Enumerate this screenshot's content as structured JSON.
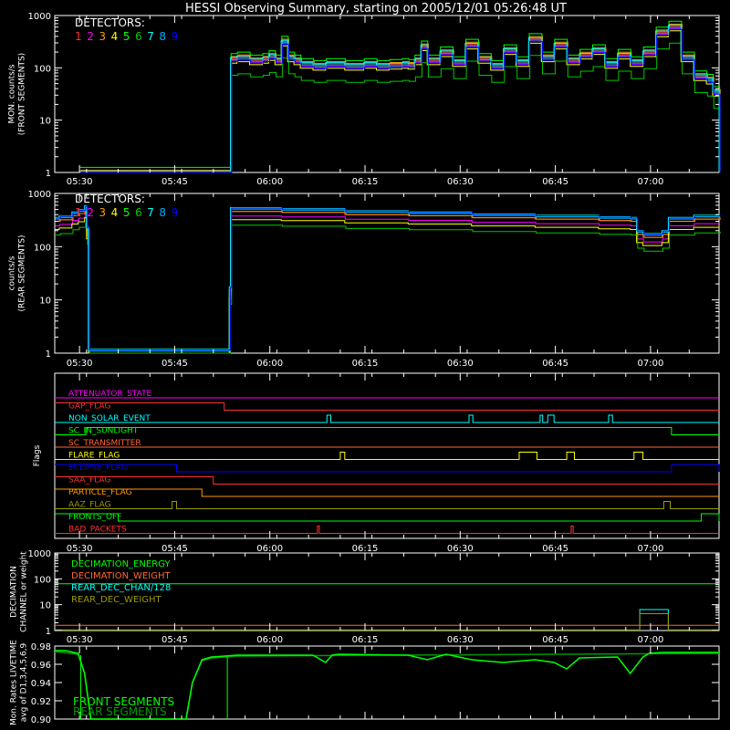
{
  "title": "HESSI Observing Summary, starting on 2005/12/01 05:26:48 UT",
  "time_ticks": [
    "05:30",
    "05:45",
    "06:00",
    "06:15",
    "06:30",
    "06:45",
    "07:00"
  ],
  "detector_colors": [
    "#ff3030",
    "#ff00ff",
    "#ff9900",
    "#ffff00",
    "#00ff00",
    "#00c800",
    "#00ffff",
    "#00aaff",
    "#0000ff"
  ],
  "chart_data": [
    {
      "type": "line",
      "ylabel": "MON. counts/s\n(FRONT SEGMENTS)",
      "y_scale": "log",
      "ylim": [
        1,
        1000
      ],
      "y_ticks": [
        "1",
        "10",
        "100",
        "1000"
      ],
      "legend_title": "DETECTORS:",
      "legend_items": [
        "1",
        "2",
        "3",
        "4",
        "5",
        "6",
        "7",
        "8",
        "9"
      ],
      "x_minutes": [
        3.2,
        26.5,
        27.0,
        28.0,
        30.0,
        32.0,
        33.0,
        34.0,
        35.0,
        36.0,
        37.0,
        38.0,
        39.0,
        40.0,
        42.0,
        45.0,
        48.0,
        50.0,
        52.0,
        54.0,
        55.0,
        56.0,
        57.0,
        58.0,
        60.0,
        62.0,
        64.0,
        66.0,
        68.0,
        70.0,
        72.0,
        74.0,
        76.0,
        78.0,
        80.0,
        82.0,
        84.0,
        86.0,
        88.0,
        90.0,
        92.0,
        94.0,
        96.0,
        98.0,
        100.0,
        101.0,
        102.0,
        103.0,
        104.0
      ],
      "series": [
        {
          "values": [
            1,
            1,
            150,
            160,
            140,
            150,
            170,
            140,
            320,
            160,
            140,
            120,
            120,
            110,
            120,
            110,
            120,
            110,
            115,
            120,
            115,
            140,
            260,
            140,
            200,
            130,
            280,
            150,
            110,
            220,
            130,
            360,
            160,
            280,
            140,
            180,
            220,
            120,
            180,
            130,
            200,
            480,
            620,
            160,
            70,
            70,
            60,
            35,
            1
          ]
        }
      ]
    },
    {
      "type": "line",
      "ylabel": "counts/s\n(REAR SEGMENTS)",
      "y_scale": "log",
      "ylim": [
        1,
        1000
      ],
      "y_ticks": [
        "1",
        "10",
        "100",
        "1000"
      ],
      "legend_title": "DETECTORS:",
      "legend_items": [
        "1",
        "2",
        "3",
        "4",
        "5",
        "6",
        "7",
        "8",
        "9"
      ],
      "x_minutes": [
        -0.7,
        0.0,
        2.0,
        3.0,
        4.0,
        4.3,
        4.6,
        26.3,
        26.8,
        27.0,
        35.0,
        45.0,
        55.0,
        65.0,
        75.0,
        85.0,
        90.0,
        91.0,
        92.0,
        95.0,
        96.0,
        100.0,
        104.0
      ],
      "series": [
        {
          "values": [
            300,
            320,
            380,
            420,
            500,
            200,
            1,
            1,
            15,
            460,
            440,
            400,
            380,
            350,
            330,
            310,
            300,
            170,
            150,
            170,
            300,
            330,
            350
          ]
        }
      ]
    },
    {
      "type": "flags",
      "ylabel": "Flags",
      "rows": [
        {
          "label": "ATTENUATOR_STATE",
          "color": "#ff00ff",
          "high": []
        },
        {
          "label": "GAP_FLAG",
          "color": "#ff3030",
          "high": [
            [
              -0.7,
              26.0
            ]
          ]
        },
        {
          "label": "NON_SOLAR_EVENT",
          "color": "#00ffff",
          "high": [
            [
              42.2,
              42.8
            ],
            [
              64.6,
              65.2
            ],
            [
              75.8,
              76.2
            ],
            [
              77.0,
              78.0
            ],
            [
              86.6,
              87.2
            ]
          ]
        },
        {
          "label": "SC_IN_SUNLIGHT",
          "color": "#00ff00",
          "high": [
            [
              4.2,
              96.5
            ]
          ]
        },
        {
          "label": "SC_TRANSMITTER",
          "color": "#ff6633",
          "high": []
        },
        {
          "label": "FLARE_FLAG",
          "color": "#ffff00",
          "high": [
            [
              44.3,
              45.0
            ],
            [
              72.5,
              75.3
            ],
            [
              80.0,
              81.2
            ],
            [
              90.6,
              92.0
            ]
          ]
        },
        {
          "label": "ECLIPSE_FLAG",
          "color": "#0000ff",
          "high": [
            [
              -0.7,
              18.5
            ],
            [
              96.5,
              104.0
            ]
          ]
        },
        {
          "label": "SAA_FLAG",
          "color": "#ff3030",
          "high": [
            [
              -0.7,
              24.3
            ]
          ]
        },
        {
          "label": "PARTICLE_FLAG",
          "color": "#ff9900",
          "high": [
            [
              -0.7,
              22.5
            ]
          ]
        },
        {
          "label": "AAZ_FLAG",
          "color": "#999900",
          "high": [
            [
              17.8,
              18.5
            ],
            [
              95.3,
              96.3
            ]
          ]
        },
        {
          "label": "FRONTS_OFF",
          "color": "#00ff00",
          "high": [
            [
              -0.7,
              9.3
            ],
            [
              101.2,
              104.0
            ]
          ]
        },
        {
          "label": "BAD_PACKETS",
          "color": "#ff3030",
          "high": [
            [
              40.7,
              41.0
            ],
            [
              80.7,
              81.0
            ]
          ]
        }
      ]
    },
    {
      "type": "line",
      "ylabel": "DECIMATION\nCHANNEL or weight",
      "y_scale": "log",
      "ylim": [
        1,
        1000
      ],
      "y_ticks": [
        "1",
        "10",
        "100",
        "1000"
      ],
      "series": [
        {
          "name": "DECIMATION_ENERGY",
          "color": "#00ff00",
          "x_minutes": [
            -0.7,
            104.0
          ],
          "values": [
            64,
            64
          ]
        },
        {
          "name": "DECIMATION_WEIGHT",
          "color": "#ff6633",
          "x_minutes": [
            -0.7,
            104.0
          ],
          "values": [
            1.6,
            1.6
          ]
        },
        {
          "name": "REAR_DEC_CHAN/128",
          "color": "#00ffff",
          "x_minutes": [
            -0.7,
            91.5,
            91.5,
            96.0,
            96.0,
            104.0
          ],
          "values": [
            1.05,
            1.05,
            6.5,
            6.5,
            1.05,
            1.05
          ]
        },
        {
          "name": "REAR_DEC_WEIGHT",
          "color": "#999900",
          "x_minutes": [
            -0.7,
            91.5,
            91.5,
            96.0,
            96.0,
            104.0
          ],
          "values": [
            1.05,
            1.05,
            4.5,
            4.5,
            1.05,
            1.05
          ]
        }
      ]
    },
    {
      "type": "line",
      "ylabel": "Mon. Rates LIVETIME\navg of D1,3,4,5,6,9",
      "ylim": [
        0.9,
        0.98
      ],
      "y_ticks": [
        "0.90",
        "0.92",
        "0.94",
        "0.96",
        "0.98"
      ],
      "series": [
        {
          "name": "FRONT SEGMENTS",
          "color": "#00ff00",
          "x_minutes": [
            -0.7,
            1.0,
            3.0,
            4.0,
            5.0,
            20.0,
            21.0,
            22.5,
            24.0,
            28.0,
            40.0,
            42.0,
            43.0,
            44.0,
            55.0,
            58.0,
            61.0,
            65.0,
            70.0,
            75.0,
            78.0,
            80.0,
            82.0,
            88.0,
            90.0,
            92.0,
            93.0,
            95.0,
            104.0
          ],
          "values": [
            0.975,
            0.975,
            0.972,
            0.95,
            0.9,
            0.9,
            0.94,
            0.965,
            0.968,
            0.97,
            0.97,
            0.962,
            0.97,
            0.971,
            0.97,
            0.965,
            0.971,
            0.965,
            0.962,
            0.965,
            0.962,
            0.955,
            0.967,
            0.968,
            0.95,
            0.968,
            0.972,
            0.973,
            0.973
          ]
        },
        {
          "name": "REAR SEGMENTS",
          "color": "#009900",
          "x_minutes": [
            -0.7,
            3.0,
            4.0,
            5.0,
            20.0,
            21.0,
            22.5,
            24.0,
            28.0,
            104.0
          ],
          "values": [
            0.974,
            0.971,
            0.95,
            0.9,
            0.9,
            0.94,
            0.964,
            0.967,
            0.969,
            0.972
          ]
        }
      ]
    }
  ]
}
